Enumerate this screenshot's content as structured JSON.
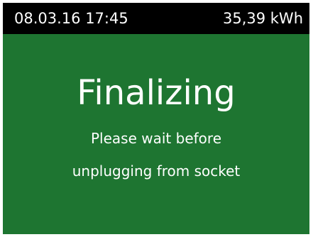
{
  "status_bar": {
    "datetime": "08.03.16 17:45",
    "energy": "35,39 kWh"
  },
  "main": {
    "title": "Finalizing",
    "message_line1": "Please wait before",
    "message_line2": "unplugging from socket"
  },
  "colors": {
    "background": "#1e7531",
    "status_bar": "#000000",
    "text": "#ffffff",
    "border": "#ffffff"
  }
}
